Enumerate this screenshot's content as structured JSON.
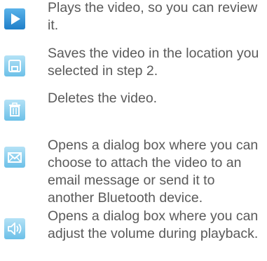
{
  "items": [
    {
      "icon": "play-icon",
      "text": "Plays the video, so you can review it."
    },
    {
      "icon": "save-icon",
      "text": "Saves the video in the location you selected in step 2."
    },
    {
      "icon": "trash-icon",
      "text": "Deletes the video."
    },
    {
      "icon": "envelope-icon",
      "text": "Opens a dialog box where you can choose to attach the video to an email message or send it to another Bluetooth device."
    },
    {
      "icon": "speaker-icon",
      "text": "Opens a dialog box where you can adjust the volume during playback."
    }
  ],
  "colors": {
    "text": "#5a5a5a",
    "icon_blue": "#2f8fd6",
    "icon_light": "#8fd0ef",
    "icon_glyph": "#ffffff"
  }
}
